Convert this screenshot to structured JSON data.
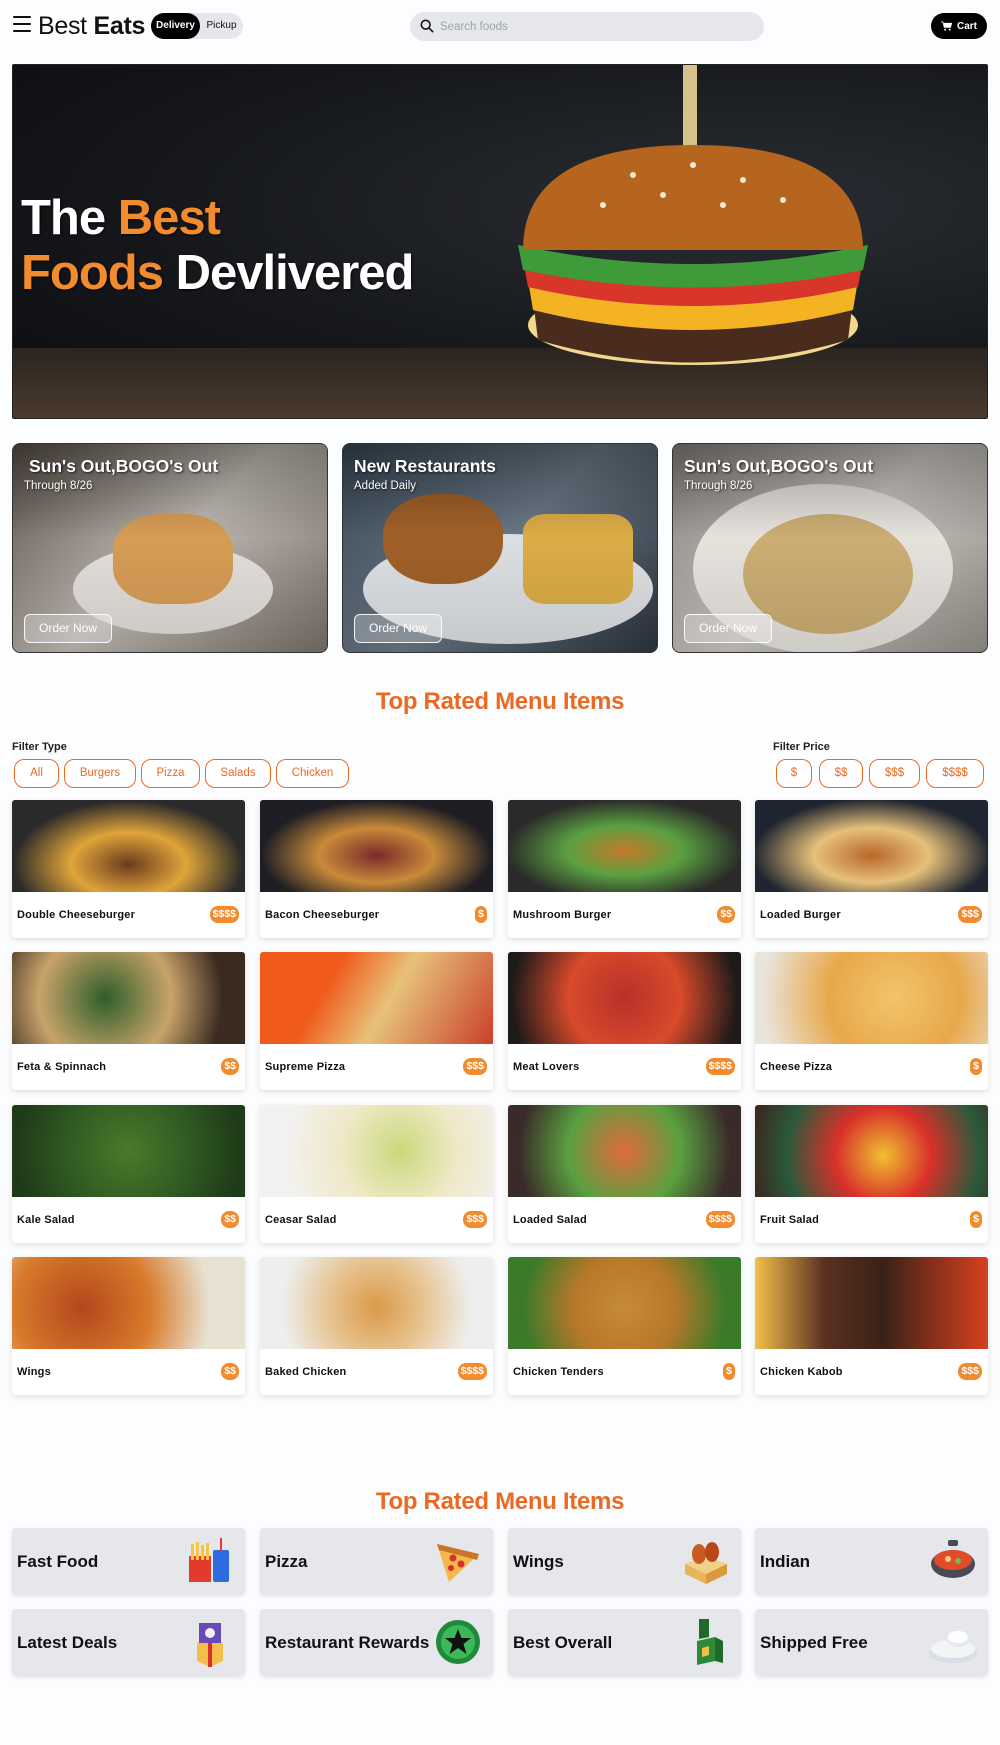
{
  "header": {
    "brand_light": "Best",
    "brand_bold": "Eats",
    "mode_active": "Delivery",
    "mode_inactive": "Pickup",
    "search_placeholder": "Search foods",
    "cart_label": "Cart"
  },
  "hero": {
    "line1_white": "The",
    "line1_accent": "Best",
    "line2_accent": "Foods",
    "line2_white": "Devlivered"
  },
  "promos": [
    {
      "title": "Sun's Out,BOGO's Out",
      "subtitle": "Through 8/26",
      "button": "Order Now"
    },
    {
      "title": "New Restaurants",
      "subtitle": "Added Daily",
      "button": "Order Now"
    },
    {
      "title": "Sun's Out,BOGO's Out",
      "subtitle": "Through 8/26",
      "button": "Order Now"
    }
  ],
  "menu_section": {
    "title": "Top Rated Menu Items",
    "filter_type_label": "Filter Type",
    "filter_type_options": [
      "All",
      "Burgers",
      "Pizza",
      "Salads",
      "Chicken"
    ],
    "filter_price_label": "Filter Price",
    "filter_price_options": [
      "$",
      "$$",
      "$$$",
      "$$$$"
    ]
  },
  "menu_items": [
    {
      "name": "Double Cheeseburger",
      "price": "$$$$"
    },
    {
      "name": "Bacon Cheeseburger",
      "price": "$"
    },
    {
      "name": "Mushroom Burger",
      "price": "$$"
    },
    {
      "name": "Loaded Burger",
      "price": "$$$"
    },
    {
      "name": "Feta & Spinnach",
      "price": "$$"
    },
    {
      "name": "Supreme Pizza",
      "price": "$$$"
    },
    {
      "name": "Meat Lovers",
      "price": "$$$$"
    },
    {
      "name": "Cheese Pizza",
      "price": "$"
    },
    {
      "name": "Kale Salad",
      "price": "$$"
    },
    {
      "name": "Ceasar Salad",
      "price": "$$$"
    },
    {
      "name": "Loaded Salad",
      "price": "$$$$"
    },
    {
      "name": "Fruit Salad",
      "price": "$"
    },
    {
      "name": "Wings",
      "price": "$$"
    },
    {
      "name": "Baked Chicken",
      "price": "$$$$"
    },
    {
      "name": "Chicken Tenders",
      "price": "$"
    },
    {
      "name": "Chicken Kabob",
      "price": "$$$"
    }
  ],
  "category_section": {
    "title": "Top Rated Menu Items"
  },
  "categories": [
    {
      "name": "Fast Food",
      "icon": "fries-and-drink-icon"
    },
    {
      "name": "Pizza",
      "icon": "pizza-slice-icon"
    },
    {
      "name": "Wings",
      "icon": "wings-box-icon"
    },
    {
      "name": "Indian",
      "icon": "curry-pot-icon"
    },
    {
      "name": "Latest Deals",
      "icon": "gift-bag-icon"
    },
    {
      "name": "Restaurant Rewards",
      "icon": "star-badge-icon"
    },
    {
      "name": "Best Overall",
      "icon": "trophy-bottle-icon"
    },
    {
      "name": "Shipped Free",
      "icon": "plates-icon"
    }
  ],
  "colors": {
    "accent": "#ea6a25",
    "price_badge": "#f28a2e",
    "hero_accent": "#f28a2e"
  }
}
